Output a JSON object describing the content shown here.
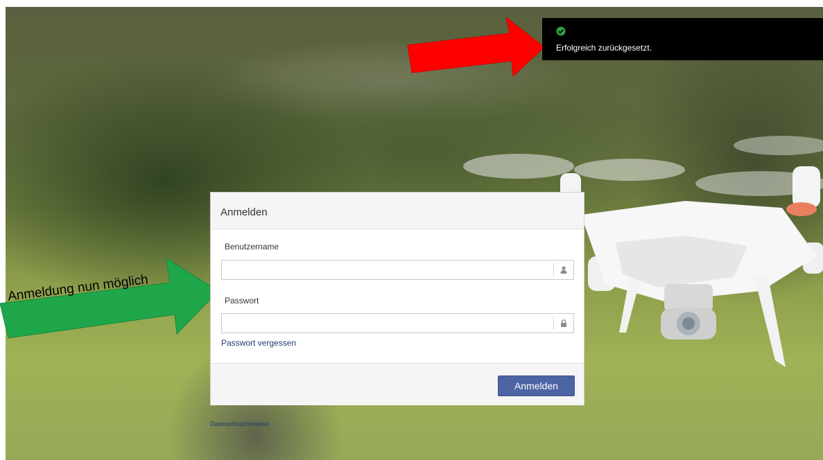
{
  "toast": {
    "icon": "check-circle-icon",
    "message": "Erfolgreich zurückgesetzt.",
    "accent_color": "#2ea043"
  },
  "annotation": {
    "label": "Anmeldung nun möglich",
    "green_arrow_color": "#1fa64a",
    "red_arrow_color": "#ff0000"
  },
  "login": {
    "title": "Anmelden",
    "username_label": "Benutzername",
    "username_value": "",
    "username_icon": "user-icon",
    "password_label": "Passwort",
    "password_value": "",
    "password_icon": "lock-icon",
    "forgot_link": "Passwort vergessen",
    "submit_label": "Anmelden",
    "submit_color": "#4d64a3"
  },
  "footer": {
    "privacy_link": "Datenschutzhinweise"
  }
}
